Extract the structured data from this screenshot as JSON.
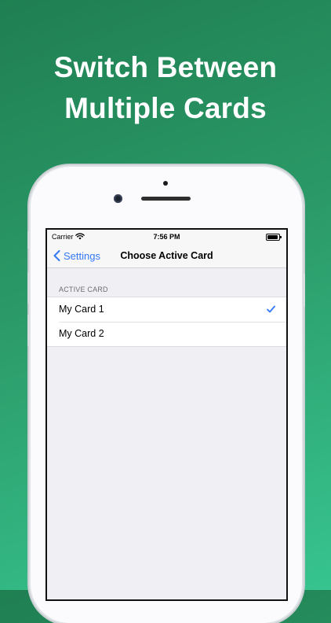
{
  "promo": {
    "headline_line1": "Switch Between",
    "headline_line2": "Multiple Cards"
  },
  "status_bar": {
    "carrier": "Carrier",
    "time": "7:56 PM",
    "icons": [
      "wifi-icon",
      "battery-icon"
    ]
  },
  "nav": {
    "back_label": "Settings",
    "title": "Choose Active Card"
  },
  "section": {
    "header": "ACTIVE CARD",
    "items": [
      {
        "label": "My Card 1",
        "selected": true
      },
      {
        "label": "My Card 2",
        "selected": false
      }
    ]
  },
  "colors": {
    "accent": "#3478f6",
    "background_top": "#1f7f52",
    "background_bottom": "#37c48f"
  }
}
